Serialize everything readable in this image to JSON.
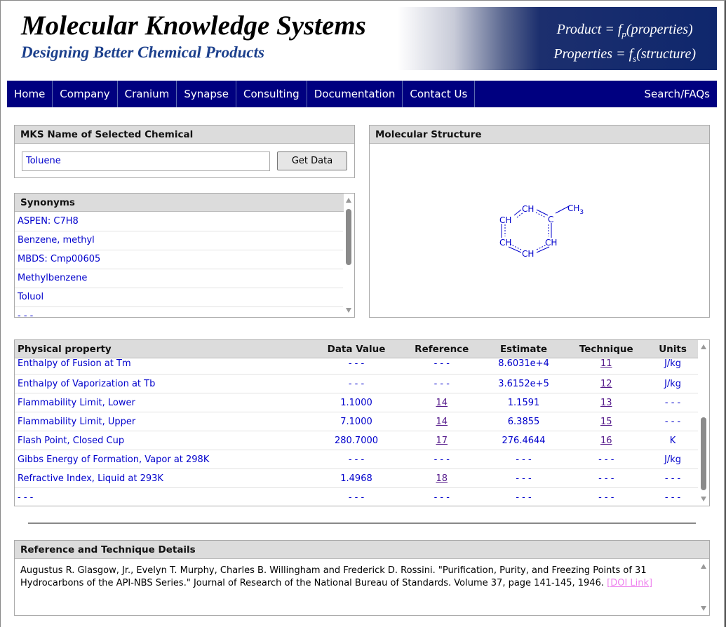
{
  "banner": {
    "title": "Molecular Knowledge Systems",
    "subtitle": "Designing Better Chemical Products",
    "formula_line1_prefix": "Product = f",
    "formula_line1_sub": "p",
    "formula_line1_suffix": "(properties)",
    "formula_line2_prefix": "Properties = f",
    "formula_line2_sub": "s",
    "formula_line2_suffix": "(structure)"
  },
  "nav": {
    "items": [
      "Home",
      "Company",
      "Cranium",
      "Synapse",
      "Consulting",
      "Documentation",
      "Contact Us"
    ],
    "right": "Search/FAQs"
  },
  "name_panel": {
    "header": "MKS Name of Selected Chemical",
    "input_value": "Toluene",
    "button_label": "Get Data"
  },
  "synonyms": {
    "header": "Synonyms",
    "items": [
      "ASPEN: C7H8",
      "Benzene, methyl",
      "MBDS: Cmp00605",
      "Methylbenzene",
      "Toluol",
      "- - -"
    ]
  },
  "structure": {
    "header": "Molecular Structure",
    "labels": [
      "CH",
      "CH",
      "C",
      "CH",
      "CH",
      "CH",
      "CH"
    ],
    "methyl": "CH",
    "methyl_sub": "3"
  },
  "properties": {
    "columns": [
      "Physical property",
      "Data Value",
      "Reference",
      "Estimate",
      "Technique",
      "Units"
    ],
    "rows": [
      {
        "name": "Enthalpy of Fusion at Tm",
        "value": "- - -",
        "ref": "- - -",
        "estimate": "8.6031e+4",
        "tech": "11",
        "units": "J/kg"
      },
      {
        "name": "Enthalpy of Vaporization at Tb",
        "value": "- - -",
        "ref": "- - -",
        "estimate": "3.6152e+5",
        "tech": "12",
        "units": "J/kg"
      },
      {
        "name": "Flammability Limit, Lower",
        "value": "1.1000",
        "ref": "14",
        "estimate": "1.1591",
        "tech": "13",
        "units": "- - -"
      },
      {
        "name": "Flammability Limit, Upper",
        "value": "7.1000",
        "ref": "14",
        "estimate": "6.3855",
        "tech": "15",
        "units": "- - -"
      },
      {
        "name": "Flash Point, Closed Cup",
        "value": "280.7000",
        "ref": "17",
        "estimate": "276.4644",
        "tech": "16",
        "units": "K"
      },
      {
        "name": "Gibbs Energy of Formation, Vapor at 298K",
        "value": "- - -",
        "ref": "- - -",
        "estimate": "- - -",
        "tech": "- - -",
        "units": "J/kg"
      },
      {
        "name": "Refractive Index, Liquid at 293K",
        "value": "1.4968",
        "ref": "18",
        "estimate": "- - -",
        "tech": "- - -",
        "units": "- - -"
      },
      {
        "name": "- - -",
        "value": "- - -",
        "ref": "- - -",
        "estimate": "- - -",
        "tech": "- - -",
        "units": "- - -"
      }
    ]
  },
  "reference": {
    "header": "Reference and Technique Details",
    "text": "Augustus R. Glasgow, Jr., Evelyn T. Murphy, Charles B. Willingham and Frederick D. Rossini. \"Purification, Purity, and Freezing Points of 31 Hydrocarbons of the API-NBS Series.\" Journal of Research of the National Bureau of Standards. Volume 37, page 141-145, 1946.",
    "link": "[DOI Link]"
  }
}
